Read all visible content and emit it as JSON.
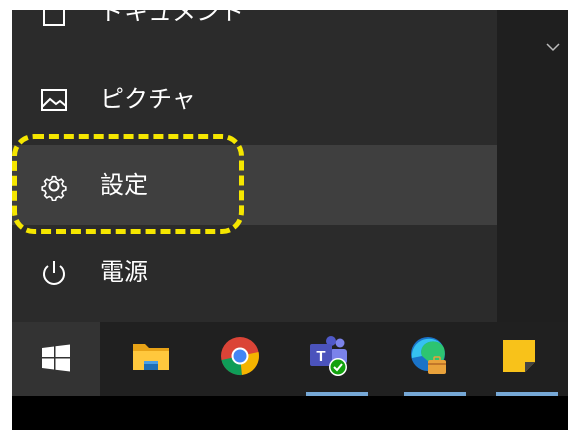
{
  "menu": {
    "documents_label": "ドキュメント",
    "pictures_label": "ピクチャ",
    "settings_label": "設定",
    "power_label": "電源"
  },
  "colors": {
    "highlight": "#f5e600",
    "menu_bg": "#2b2b2b",
    "hover_bg": "#3f3f3f",
    "taskbar_bg": "#202020",
    "running_indicator": "#76a8d6"
  },
  "icons": {
    "documents": "document-icon",
    "pictures": "picture-icon",
    "settings": "gear-icon",
    "power": "power-icon",
    "expand": "chevron-down-icon"
  },
  "taskbar": {
    "items": [
      {
        "name": "start-button",
        "icon": "windows-logo-icon"
      },
      {
        "name": "file-explorer",
        "icon": "folder-icon",
        "running": false
      },
      {
        "name": "chrome",
        "icon": "chrome-icon",
        "running": false
      },
      {
        "name": "teams",
        "icon": "teams-icon",
        "running": true
      },
      {
        "name": "edge",
        "icon": "edge-icon",
        "running": true
      },
      {
        "name": "sticky-notes",
        "icon": "sticky-notes-icon",
        "running": true
      }
    ]
  }
}
